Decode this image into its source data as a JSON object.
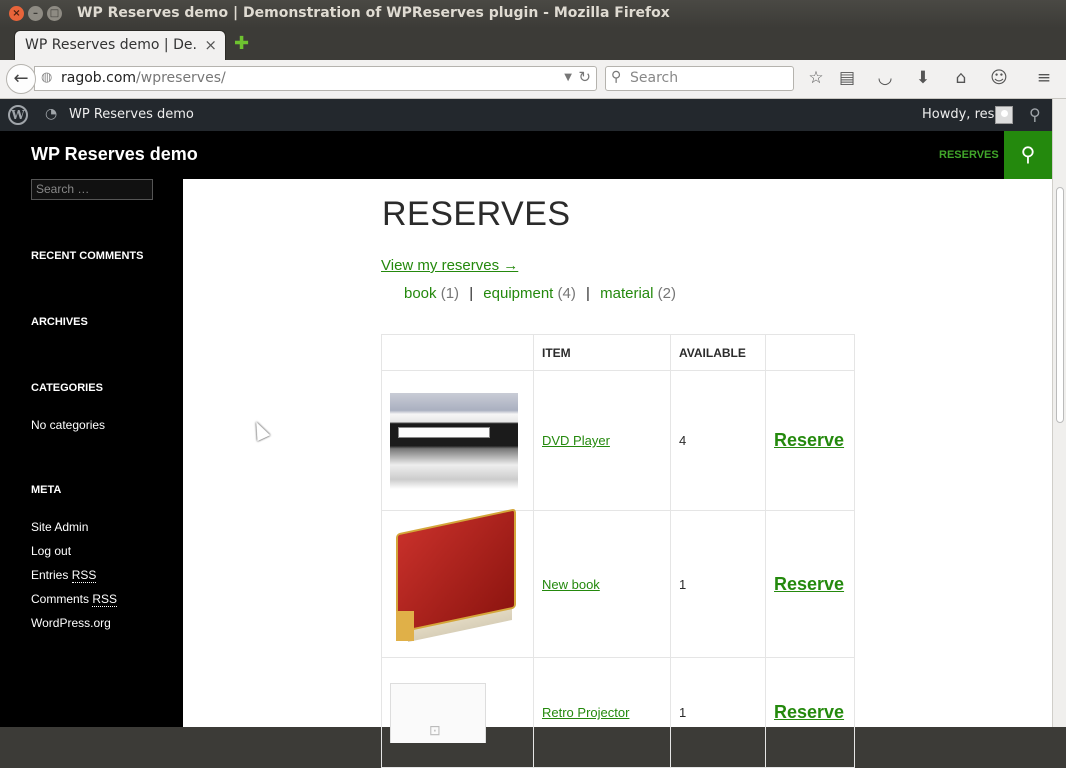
{
  "window": {
    "title": "WP Reserves demo | Demonstration of WPReserves plugin - Mozilla Firefox"
  },
  "browser": {
    "tab_label": "WP Reserves demo | De...",
    "url_host": "ragob.com",
    "url_path": "/wpreserves/",
    "search_placeholder": "Search"
  },
  "adminbar": {
    "site_name": "WP Reserves demo",
    "howdy": "Howdy, res"
  },
  "header": {
    "site_title": "WP Reserves demo",
    "menu_reserves": "RESERVES"
  },
  "sidebar": {
    "search_placeholder": "Search …",
    "recent_comments": "RECENT COMMENTS",
    "archives": "ARCHIVES",
    "categories": "CATEGORIES",
    "no_categories": "No categories",
    "meta": "META",
    "meta_links": {
      "site_admin": "Site Admin",
      "log_out": "Log out",
      "entries_prefix": "Entries",
      "comments_prefix": "Comments",
      "rss": "RSS",
      "wordpress_org": "WordPress.org"
    }
  },
  "main": {
    "page_title": "RESERVES",
    "view_my_reserves": "View my reserves →",
    "categories": [
      {
        "name": "book",
        "count": "(1)"
      },
      {
        "name": "equipment",
        "count": "(4)"
      },
      {
        "name": "material",
        "count": "(2)"
      }
    ],
    "separator": "|",
    "table": {
      "headers": [
        "",
        "ITEM",
        "AVAILABLE",
        ""
      ],
      "rows": [
        {
          "item": "DVD Player",
          "available": "4",
          "action": "Reserve"
        },
        {
          "item": "New book",
          "available": "1",
          "action": "Reserve"
        },
        {
          "item": "Retro Projector",
          "available": "1",
          "action": "Reserve"
        }
      ]
    }
  },
  "colors": {
    "link_green": "#24890d",
    "menu_green": "#41a62a",
    "admin_bar": "#23282d",
    "sidebar_bg": "#000000"
  },
  "icons": [
    "close-icon",
    "minimize-icon",
    "maximize-icon",
    "new-tab-icon",
    "back-icon",
    "globe-icon",
    "reload-icon",
    "search-icon",
    "bookmark-star-icon",
    "reading-list-icon",
    "pocket-icon",
    "download-icon",
    "home-icon",
    "chat-icon",
    "menu-icon",
    "wordpress-icon",
    "dashboard-icon"
  ]
}
